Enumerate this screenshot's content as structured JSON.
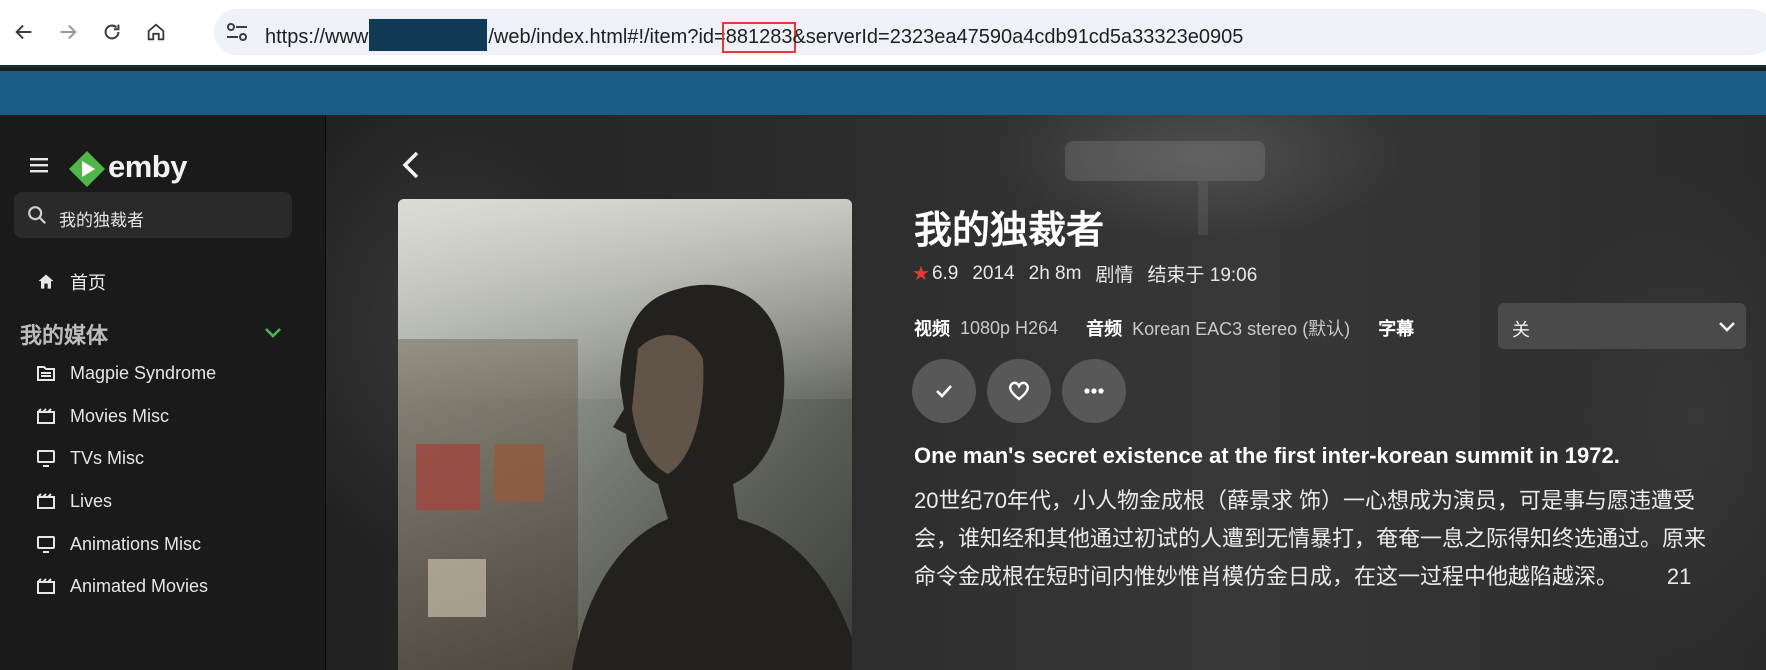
{
  "browser": {
    "url_prefix": "https://www",
    "url_path": "/web/index.html#!/item?id=",
    "item_id": "881283",
    "url_suffix": "&serverId=2323ea47590a4cdb91cd5a33323e0905"
  },
  "sidebar": {
    "logo_text": "emby",
    "search_value": "我的独裁者",
    "home_label": "首页",
    "section_title": "我的媒体",
    "libraries": [
      {
        "label": "Magpie Syndrome",
        "icon": "folder-icon"
      },
      {
        "label": "Movies Misc",
        "icon": "movie-icon"
      },
      {
        "label": "TVs Misc",
        "icon": "tv-icon"
      },
      {
        "label": "Lives",
        "icon": "movie-icon"
      },
      {
        "label": "Animations Misc",
        "icon": "tv-icon"
      },
      {
        "label": "Animated Movies",
        "icon": "movie-icon"
      }
    ]
  },
  "item": {
    "title": "我的独裁者",
    "rating": "6.9",
    "year": "2014",
    "runtime": "2h 8m",
    "genre": "剧情",
    "ends_at": "结束于 19:06",
    "video_label": "视频",
    "video_value": "1080p H264",
    "audio_label": "音频",
    "audio_value": "Korean EAC3 stereo (默认)",
    "subtitle_label": "字幕",
    "subtitle_value": "关",
    "tagline": "One man's secret existence at the first inter-korean summit in 1972.",
    "overview_lines": [
      "20世纪70年代，小人物金成根（薛景求 饰）一心想成为演员，可是事与愿违遭受",
      "会，谁知经和其他通过初试的人遭到无情暴打，奄奄一息之际得知终选通过。原来",
      "命令金成根在短时间内惟妙惟肖模仿金日成，在这一过程中他越陷越深。        21"
    ]
  },
  "colors": {
    "accent_green": "#52b54b",
    "rating_star": "#e53935",
    "band_blue": "#1b5c84"
  }
}
